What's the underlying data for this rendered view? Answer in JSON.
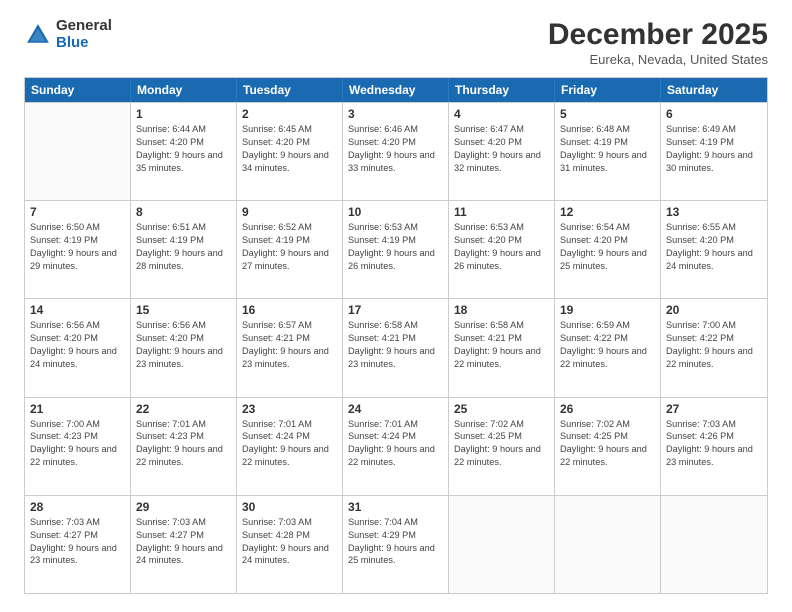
{
  "logo": {
    "general": "General",
    "blue": "Blue"
  },
  "header": {
    "title": "December 2025",
    "subtitle": "Eureka, Nevada, United States"
  },
  "days": [
    "Sunday",
    "Monday",
    "Tuesday",
    "Wednesday",
    "Thursday",
    "Friday",
    "Saturday"
  ],
  "weeks": [
    [
      {
        "num": "",
        "sunrise": "",
        "sunset": "",
        "daylight": ""
      },
      {
        "num": "1",
        "sunrise": "Sunrise: 6:44 AM",
        "sunset": "Sunset: 4:20 PM",
        "daylight": "Daylight: 9 hours and 35 minutes."
      },
      {
        "num": "2",
        "sunrise": "Sunrise: 6:45 AM",
        "sunset": "Sunset: 4:20 PM",
        "daylight": "Daylight: 9 hours and 34 minutes."
      },
      {
        "num": "3",
        "sunrise": "Sunrise: 6:46 AM",
        "sunset": "Sunset: 4:20 PM",
        "daylight": "Daylight: 9 hours and 33 minutes."
      },
      {
        "num": "4",
        "sunrise": "Sunrise: 6:47 AM",
        "sunset": "Sunset: 4:20 PM",
        "daylight": "Daylight: 9 hours and 32 minutes."
      },
      {
        "num": "5",
        "sunrise": "Sunrise: 6:48 AM",
        "sunset": "Sunset: 4:19 PM",
        "daylight": "Daylight: 9 hours and 31 minutes."
      },
      {
        "num": "6",
        "sunrise": "Sunrise: 6:49 AM",
        "sunset": "Sunset: 4:19 PM",
        "daylight": "Daylight: 9 hours and 30 minutes."
      }
    ],
    [
      {
        "num": "7",
        "sunrise": "Sunrise: 6:50 AM",
        "sunset": "Sunset: 4:19 PM",
        "daylight": "Daylight: 9 hours and 29 minutes."
      },
      {
        "num": "8",
        "sunrise": "Sunrise: 6:51 AM",
        "sunset": "Sunset: 4:19 PM",
        "daylight": "Daylight: 9 hours and 28 minutes."
      },
      {
        "num": "9",
        "sunrise": "Sunrise: 6:52 AM",
        "sunset": "Sunset: 4:19 PM",
        "daylight": "Daylight: 9 hours and 27 minutes."
      },
      {
        "num": "10",
        "sunrise": "Sunrise: 6:53 AM",
        "sunset": "Sunset: 4:19 PM",
        "daylight": "Daylight: 9 hours and 26 minutes."
      },
      {
        "num": "11",
        "sunrise": "Sunrise: 6:53 AM",
        "sunset": "Sunset: 4:20 PM",
        "daylight": "Daylight: 9 hours and 26 minutes."
      },
      {
        "num": "12",
        "sunrise": "Sunrise: 6:54 AM",
        "sunset": "Sunset: 4:20 PM",
        "daylight": "Daylight: 9 hours and 25 minutes."
      },
      {
        "num": "13",
        "sunrise": "Sunrise: 6:55 AM",
        "sunset": "Sunset: 4:20 PM",
        "daylight": "Daylight: 9 hours and 24 minutes."
      }
    ],
    [
      {
        "num": "14",
        "sunrise": "Sunrise: 6:56 AM",
        "sunset": "Sunset: 4:20 PM",
        "daylight": "Daylight: 9 hours and 24 minutes."
      },
      {
        "num": "15",
        "sunrise": "Sunrise: 6:56 AM",
        "sunset": "Sunset: 4:20 PM",
        "daylight": "Daylight: 9 hours and 23 minutes."
      },
      {
        "num": "16",
        "sunrise": "Sunrise: 6:57 AM",
        "sunset": "Sunset: 4:21 PM",
        "daylight": "Daylight: 9 hours and 23 minutes."
      },
      {
        "num": "17",
        "sunrise": "Sunrise: 6:58 AM",
        "sunset": "Sunset: 4:21 PM",
        "daylight": "Daylight: 9 hours and 23 minutes."
      },
      {
        "num": "18",
        "sunrise": "Sunrise: 6:58 AM",
        "sunset": "Sunset: 4:21 PM",
        "daylight": "Daylight: 9 hours and 22 minutes."
      },
      {
        "num": "19",
        "sunrise": "Sunrise: 6:59 AM",
        "sunset": "Sunset: 4:22 PM",
        "daylight": "Daylight: 9 hours and 22 minutes."
      },
      {
        "num": "20",
        "sunrise": "Sunrise: 7:00 AM",
        "sunset": "Sunset: 4:22 PM",
        "daylight": "Daylight: 9 hours and 22 minutes."
      }
    ],
    [
      {
        "num": "21",
        "sunrise": "Sunrise: 7:00 AM",
        "sunset": "Sunset: 4:23 PM",
        "daylight": "Daylight: 9 hours and 22 minutes."
      },
      {
        "num": "22",
        "sunrise": "Sunrise: 7:01 AM",
        "sunset": "Sunset: 4:23 PM",
        "daylight": "Daylight: 9 hours and 22 minutes."
      },
      {
        "num": "23",
        "sunrise": "Sunrise: 7:01 AM",
        "sunset": "Sunset: 4:24 PM",
        "daylight": "Daylight: 9 hours and 22 minutes."
      },
      {
        "num": "24",
        "sunrise": "Sunrise: 7:01 AM",
        "sunset": "Sunset: 4:24 PM",
        "daylight": "Daylight: 9 hours and 22 minutes."
      },
      {
        "num": "25",
        "sunrise": "Sunrise: 7:02 AM",
        "sunset": "Sunset: 4:25 PM",
        "daylight": "Daylight: 9 hours and 22 minutes."
      },
      {
        "num": "26",
        "sunrise": "Sunrise: 7:02 AM",
        "sunset": "Sunset: 4:25 PM",
        "daylight": "Daylight: 9 hours and 22 minutes."
      },
      {
        "num": "27",
        "sunrise": "Sunrise: 7:03 AM",
        "sunset": "Sunset: 4:26 PM",
        "daylight": "Daylight: 9 hours and 23 minutes."
      }
    ],
    [
      {
        "num": "28",
        "sunrise": "Sunrise: 7:03 AM",
        "sunset": "Sunset: 4:27 PM",
        "daylight": "Daylight: 9 hours and 23 minutes."
      },
      {
        "num": "29",
        "sunrise": "Sunrise: 7:03 AM",
        "sunset": "Sunset: 4:27 PM",
        "daylight": "Daylight: 9 hours and 24 minutes."
      },
      {
        "num": "30",
        "sunrise": "Sunrise: 7:03 AM",
        "sunset": "Sunset: 4:28 PM",
        "daylight": "Daylight: 9 hours and 24 minutes."
      },
      {
        "num": "31",
        "sunrise": "Sunrise: 7:04 AM",
        "sunset": "Sunset: 4:29 PM",
        "daylight": "Daylight: 9 hours and 25 minutes."
      },
      {
        "num": "",
        "sunrise": "",
        "sunset": "",
        "daylight": ""
      },
      {
        "num": "",
        "sunrise": "",
        "sunset": "",
        "daylight": ""
      },
      {
        "num": "",
        "sunrise": "",
        "sunset": "",
        "daylight": ""
      }
    ]
  ]
}
